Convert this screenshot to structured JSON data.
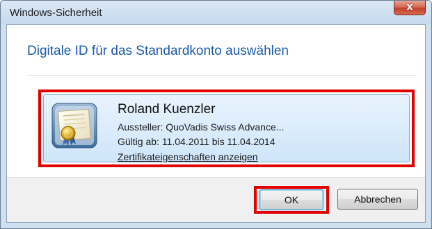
{
  "window": {
    "title": "Windows-Sicherheit",
    "close_glyph": "x"
  },
  "dialog": {
    "heading": "Digitale ID für das Standardkonto auswählen"
  },
  "certificate": {
    "icon": "certificate-icon",
    "name": "Roland Kuenzler",
    "issuer": "Aussteller: QuoVadis Swiss Advance...",
    "validity": "Gültig ab: 11.04.2011 bis 11.04.2014",
    "properties_link": "Zertifikateigenschaften anzeigen"
  },
  "buttons": {
    "ok": "OK",
    "cancel": "Abbrechen"
  },
  "colors": {
    "highlight": "#e00000",
    "heading": "#1d5aa8",
    "selection": "#cfe5fa"
  }
}
